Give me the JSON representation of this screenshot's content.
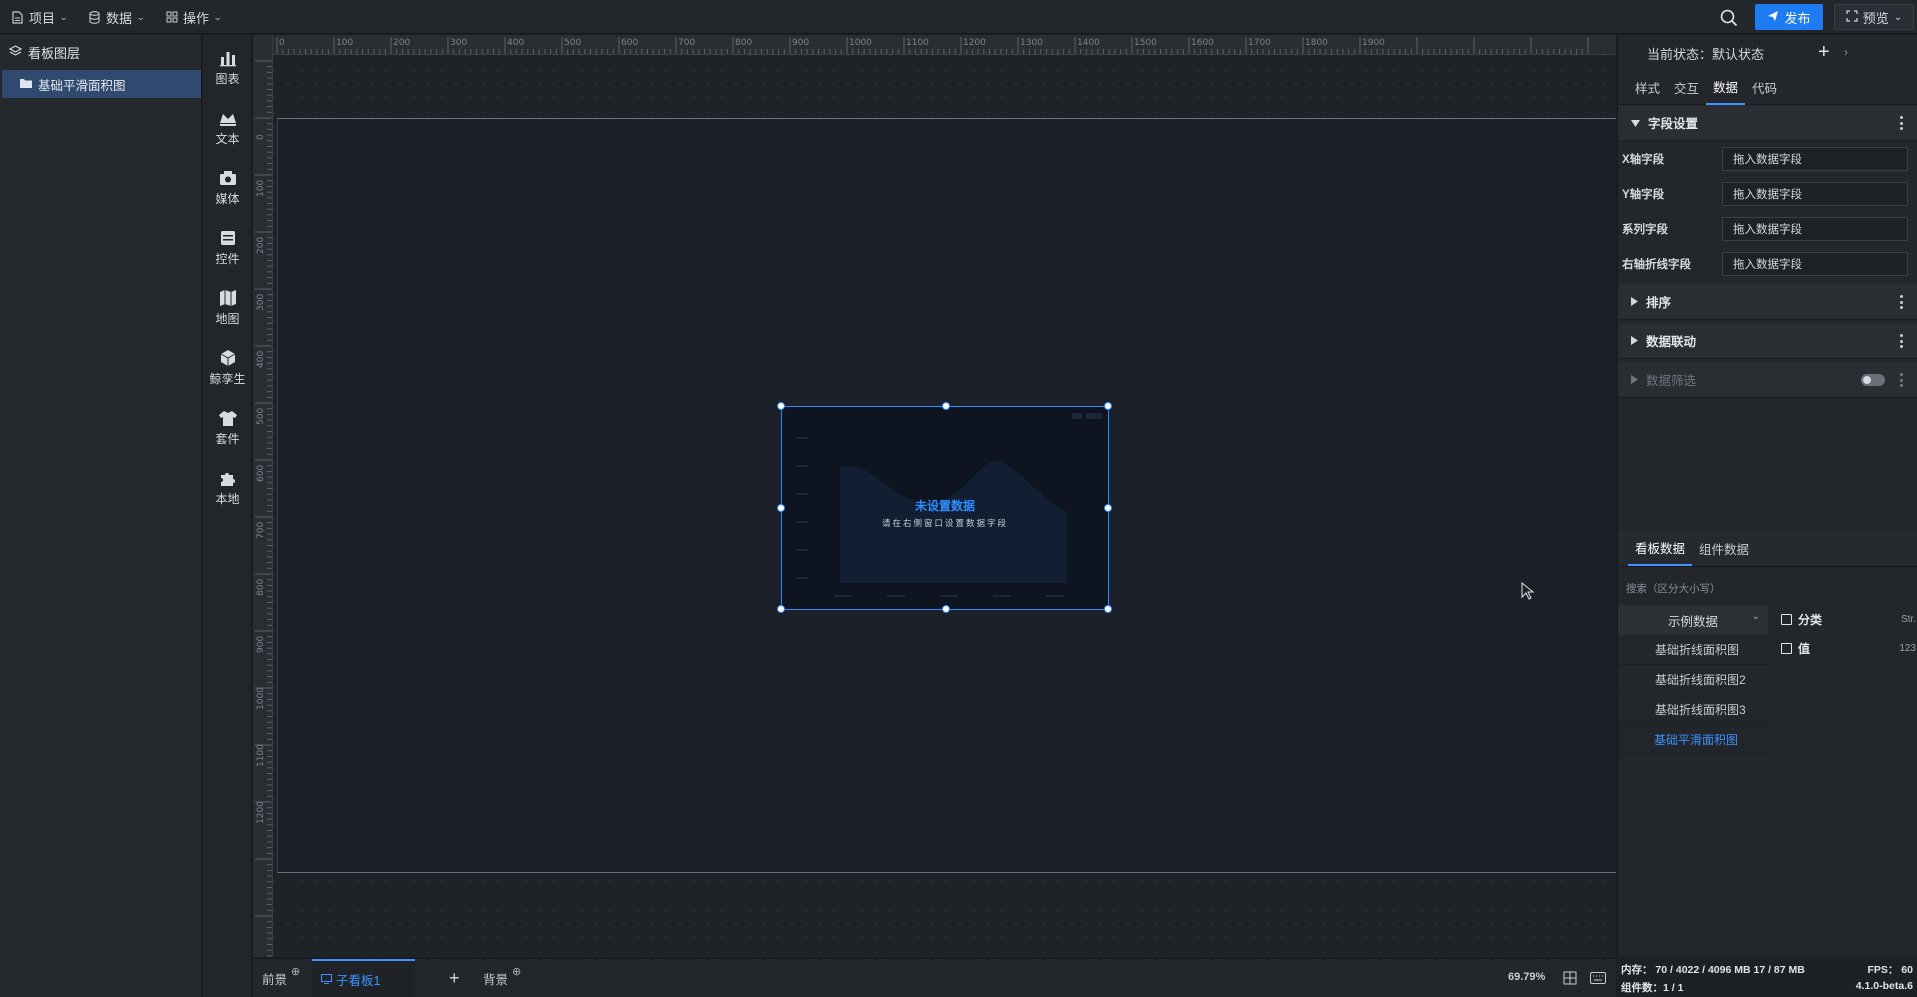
{
  "topbar": {
    "menus": [
      {
        "label": "项目",
        "icon": "file-icon"
      },
      {
        "label": "数据",
        "icon": "database-icon"
      },
      {
        "label": "操作",
        "icon": "grid-icon"
      }
    ],
    "publish_label": "发布",
    "preview_label": "预览"
  },
  "layers": {
    "title": "看板图层",
    "items": [
      {
        "label": "基础平滑面积图"
      }
    ]
  },
  "components": [
    {
      "label": "图表",
      "icon": "chart-icon"
    },
    {
      "label": "文本",
      "icon": "text-icon"
    },
    {
      "label": "媒体",
      "icon": "media-icon"
    },
    {
      "label": "控件",
      "icon": "control-icon"
    },
    {
      "label": "地图",
      "icon": "map-icon"
    },
    {
      "label": "鲸孪生",
      "icon": "cube-icon"
    },
    {
      "label": "套件",
      "icon": "shirt-icon"
    },
    {
      "label": "本地",
      "icon": "puzzle-icon"
    }
  ],
  "ruler": {
    "top_ticks": [
      "0",
      "100",
      "200",
      "300",
      "400",
      "500",
      "600",
      "700",
      "800",
      "900",
      "1000",
      "1100",
      "1200",
      "1300",
      "1400",
      "1500",
      "1600",
      "1700",
      "1800",
      "1900"
    ],
    "left_ticks": [
      "0",
      "100",
      "200",
      "300",
      "400",
      "500",
      "600",
      "700",
      "800",
      "900",
      "1000",
      "1100",
      "1200"
    ]
  },
  "widget": {
    "empty_title": "未设置数据",
    "empty_hint": "请在右侧窗口设置数据字段"
  },
  "bottom": {
    "tabs": [
      {
        "label": "前景",
        "active": false
      },
      {
        "label": "子看板1",
        "active": true
      },
      {
        "label": "背景",
        "active": false
      }
    ],
    "zoom": "69.79%"
  },
  "right": {
    "state_label": "当前状态：默认状态",
    "tabs": [
      "样式",
      "交互",
      "数据",
      "代码"
    ],
    "active_tab": "数据",
    "field_section": "字段设置",
    "fields": [
      {
        "label": "X轴字段",
        "placeholder": "拖入数据字段"
      },
      {
        "label": "Y轴字段",
        "placeholder": "拖入数据字段"
      },
      {
        "label": "系列字段",
        "placeholder": "拖入数据字段"
      },
      {
        "label": "右轴折线字段",
        "placeholder": "拖入数据字段"
      }
    ],
    "sections": [
      "排序",
      "数据联动",
      "数据筛选"
    ],
    "data_tabs": [
      "看板数据",
      "组件数据"
    ],
    "search_hint": "搜索（区分大小写）",
    "dataset_group": "示例数据",
    "datasets": [
      "基础折线面积图",
      "基础折线面积图2",
      "基础折线面积图3",
      "基础平滑面积图"
    ],
    "active_dataset": "基础平滑面积图",
    "data_fields": [
      {
        "name": "分类",
        "type": "Str."
      },
      {
        "name": "值",
        "type": "123"
      }
    ]
  },
  "status": {
    "memory": "内存：  70 / 4022 / 4096 MB  17 / 87 MB",
    "fps": "FPS：  60",
    "count": "组件数：1 / 1",
    "version": "4.1.0-beta.6"
  },
  "colors": {
    "accent": "#1d7cf2",
    "active_layer": "#2f4a6e"
  }
}
